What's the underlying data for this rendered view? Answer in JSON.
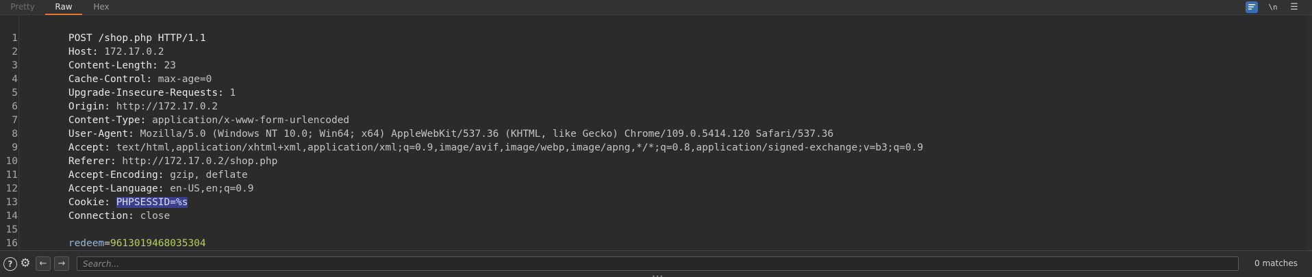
{
  "tabs": {
    "pretty": "Pretty",
    "raw": "Raw",
    "hex": "Hex"
  },
  "toolbar": {
    "wrap_icon": "word-wrap-icon",
    "newline_label": "\\n",
    "menu_icon": "hamburger-menu-icon"
  },
  "request": {
    "lines": [
      {
        "num": "1",
        "text": "POST /shop.php HTTP/1.1"
      },
      {
        "num": "2",
        "name": "Host",
        "value": " 172.17.0.2"
      },
      {
        "num": "3",
        "name": "Content-Length",
        "value": " 23"
      },
      {
        "num": "4",
        "name": "Cache-Control",
        "value": " max-age=0"
      },
      {
        "num": "5",
        "name": "Upgrade-Insecure-Requests",
        "value": " 1"
      },
      {
        "num": "6",
        "name": "Origin",
        "value": " http://172.17.0.2"
      },
      {
        "num": "7",
        "name": "Content-Type",
        "value": " application/x-www-form-urlencoded"
      },
      {
        "num": "8",
        "name": "User-Agent",
        "value": " Mozilla/5.0 (Windows NT 10.0; Win64; x64) AppleWebKit/537.36 (KHTML, like Gecko) Chrome/109.0.5414.120 Safari/537.36"
      },
      {
        "num": "9",
        "name": "Accept",
        "value": " text/html,application/xhtml+xml,application/xml;q=0.9,image/avif,image/webp,image/apng,*/*;q=0.8,application/signed-exchange;v=b3;q=0.9"
      },
      {
        "num": "10",
        "name": "Referer",
        "value": " http://172.17.0.2/shop.php"
      },
      {
        "num": "11",
        "name": "Accept-Encoding",
        "value": " gzip, deflate"
      },
      {
        "num": "12",
        "name": "Accept-Language",
        "value": " en-US,en;q=0.9"
      },
      {
        "num": "13",
        "name": "Cookie",
        "value": " ",
        "highlight": "PHPSESSID=%s"
      },
      {
        "num": "14",
        "name": "Connection",
        "value": " close"
      },
      {
        "num": "15"
      },
      {
        "num": "16",
        "param_key": "redeem",
        "param_eq": "=",
        "param_value": "9613019468035304"
      }
    ]
  },
  "search": {
    "placeholder": "Search...",
    "matches": "0 matches"
  },
  "colors": {
    "accent": "#e3772c",
    "highlight": "#3a3f8c",
    "param_value": "#b7cf58",
    "param_key": "#8fb9e0"
  }
}
